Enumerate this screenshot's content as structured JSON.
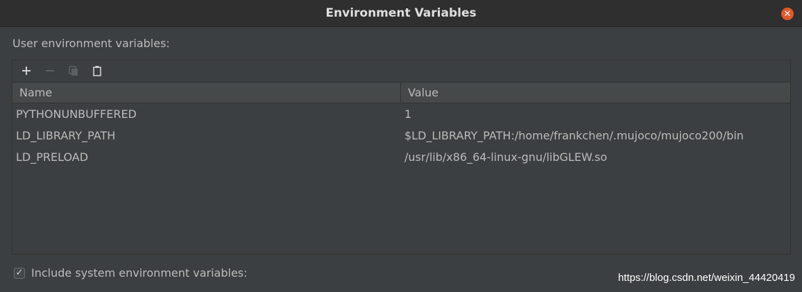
{
  "window": {
    "title": "Environment Variables",
    "close_icon": "close-icon"
  },
  "section": {
    "label": "User environment variables:"
  },
  "toolbar": {
    "add_icon": "+",
    "remove_icon": "−",
    "copy_icon": "⧉",
    "paste_icon": "📋"
  },
  "table": {
    "headers": {
      "name": "Name",
      "value": "Value"
    },
    "rows": [
      {
        "name": "PYTHONUNBUFFERED",
        "value": "1"
      },
      {
        "name": "LD_LIBRARY_PATH",
        "value": "$LD_LIBRARY_PATH:/home/frankchen/.mujoco/mujoco200/bin"
      },
      {
        "name": "LD_PRELOAD",
        "value": "/usr/lib/x86_64-linux-gnu/libGLEW.so"
      }
    ]
  },
  "options": {
    "include_system_label": "Include system environment variables:",
    "include_system_checked": true
  },
  "watermark": "https://blog.csdn.net/weixin_44420419",
  "colors": {
    "background": "#3c3f41",
    "titlebar": "#2f2f2f",
    "close_button": "#e05a2f"
  }
}
